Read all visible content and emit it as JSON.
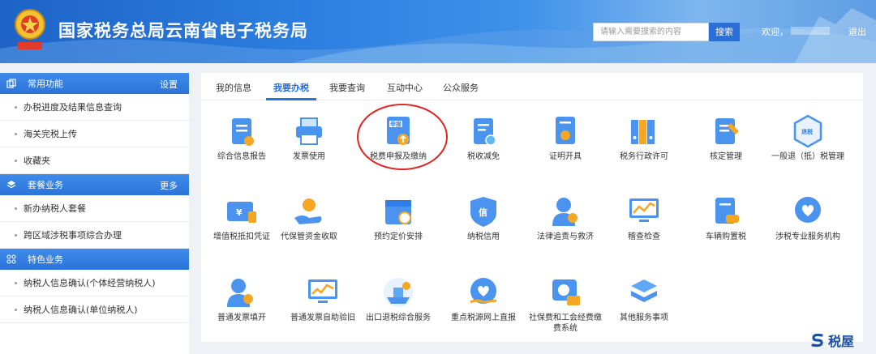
{
  "header": {
    "title": "国家税务总局云南省电子税务局",
    "emblem_label": "中国税务",
    "search_placeholder": "请输入需要搜索的内容",
    "search_button": "搜索",
    "welcome": "欢迎，",
    "logout": "退出"
  },
  "sidebar": {
    "sections": [
      {
        "title": "常用功能",
        "more": "设置",
        "icon": "copy-icon",
        "items": [
          "办税进度及结果信息查询",
          "海关完税上传",
          "收藏夹"
        ]
      },
      {
        "title": "套餐业务",
        "more": "更多",
        "icon": "layers-icon",
        "items": [
          "新办纳税人套餐",
          "跨区域涉税事项综合办理"
        ]
      },
      {
        "title": "特色业务",
        "more": "",
        "icon": "grid-icon",
        "items": [
          "纳税人信息确认(个体经营纳税人)",
          "纳税人信息确认(单位纳税人)"
        ]
      }
    ]
  },
  "tabs": [
    "我的信息",
    "我要办税",
    "我要查询",
    "互动中心",
    "公众服务"
  ],
  "active_tab": "我要办税",
  "services": [
    {
      "label": "综合信息报告",
      "icon": "report-icon"
    },
    {
      "label": "发票使用",
      "icon": "printer-icon"
    },
    {
      "label": "税费申报及缴纳",
      "icon": "declare-icon",
      "badge": "申报"
    },
    {
      "label": "税收减免",
      "icon": "reduce-icon"
    },
    {
      "label": "证明开具",
      "icon": "certificate-icon"
    },
    {
      "label": "税务行政许可",
      "icon": "binders-icon"
    },
    {
      "label": "核定管理",
      "icon": "checklist-icon"
    },
    {
      "label": "一般退（抵）税管理",
      "icon": "refund-icon",
      "badge": "退税"
    },
    {
      "label": "增值税抵扣凭证",
      "icon": "voucher-icon",
      "badge": "¥"
    },
    {
      "label": "代保管资金收取",
      "icon": "hand-money-icon"
    },
    {
      "label": "预约定价安排",
      "icon": "calendar-icon"
    },
    {
      "label": "纳税信用",
      "icon": "credit-icon",
      "badge": "信"
    },
    {
      "label": "法律追责与救济",
      "icon": "legal-icon"
    },
    {
      "label": "稽查检查",
      "icon": "monitor-chart-icon"
    },
    {
      "label": "车辆购置税",
      "icon": "vehicle-doc-icon"
    },
    {
      "label": "涉税专业服务机构",
      "icon": "heart-hand-icon"
    },
    {
      "label": "普通发票填开",
      "icon": "person-invoice-icon"
    },
    {
      "label": "普通发票自助验旧",
      "icon": "monitor-trend-icon"
    },
    {
      "label": "出口退税综合服务",
      "icon": "ship-icon"
    },
    {
      "label": "重点税源网上直报",
      "icon": "heart-chat-icon"
    },
    {
      "label": "社保费和工会经费缴费系统",
      "icon": "social-insurance-icon"
    },
    {
      "label": "其他服务事项",
      "icon": "stack-icon"
    }
  ],
  "brand": {
    "text": "税屋"
  },
  "colors": {
    "primary": "#2a74d8",
    "highlight": "#e2241f",
    "icon_blue": "#3d8ef0",
    "icon_orange": "#f5a623"
  }
}
